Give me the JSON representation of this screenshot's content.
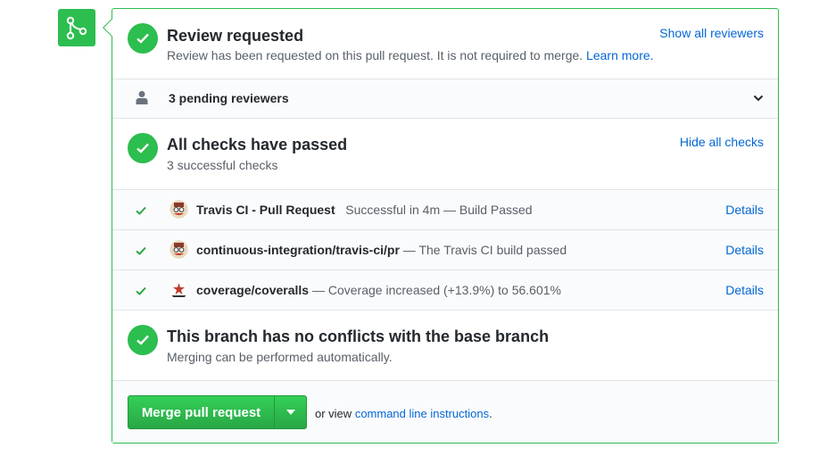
{
  "review": {
    "title": "Review requested",
    "description": "Review has been requested on this pull request. It is not required to merge.",
    "learn_more": "Learn more.",
    "show_all": "Show all reviewers"
  },
  "pending": {
    "label": "3 pending reviewers"
  },
  "checks": {
    "title": "All checks have passed",
    "subtitle": "3 successful checks",
    "hide_all": "Hide all checks",
    "items": [
      {
        "name": "Travis CI - Pull Request",
        "description": "Successful in 4m — Build Passed",
        "separator": "   ",
        "details": "Details",
        "icon": "travis-ci-logo"
      },
      {
        "name": "continuous-integration/travis-ci/pr",
        "description": "The Travis CI build passed",
        "separator": " — ",
        "details": "Details",
        "icon": "travis-ci-logo"
      },
      {
        "name": "coverage/coveralls",
        "description": "Coverage increased (+13.9%) to 56.601%",
        "separator": " — ",
        "details": "Details",
        "icon": "coveralls-logo"
      }
    ]
  },
  "conflicts": {
    "title": "This branch has no conflicts with the base branch",
    "subtitle": "Merging can be performed automatically."
  },
  "merge": {
    "button_label": "Merge pull request",
    "alt_prefix": "or view",
    "alt_link": "command line instructions",
    "alt_suffix": "."
  },
  "colors": {
    "success": "#2cbe4e",
    "link": "#0366d6",
    "border": "#e1e4e8"
  }
}
